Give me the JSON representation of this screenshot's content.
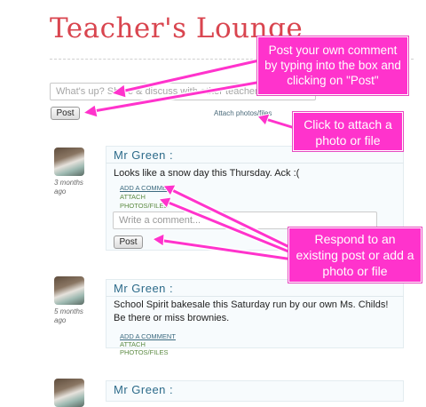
{
  "page": {
    "title": "Teacher's Lounge"
  },
  "composer": {
    "placeholder": "What's up? Share & discuss with other teachers",
    "post_label": "Post",
    "attach_label": "Attach photos/files"
  },
  "posts": [
    {
      "author": "Mr Green :",
      "ago": "3 months ago",
      "body": "Looks like a snow day this Thursday. Ack :(",
      "add_comment": "ADD A COMMENT",
      "attach": "ATTACH",
      "photos_files": "PHOTOS/FILES",
      "write_placeholder": "Write a comment...",
      "post_label": "Post"
    },
    {
      "author": "Mr Green :",
      "ago": "5 months ago",
      "body": "School Spirit bakesale this Saturday run by our own Ms. Childs! Be there or miss brownies.",
      "add_comment": "ADD A COMMENT",
      "attach": "ATTACH",
      "photos_files": "PHOTOS/FILES"
    },
    {
      "author": "Mr Green :"
    }
  ],
  "callouts": {
    "post_hint": "Post your own comment by typing into the box and clicking on \"Post\"",
    "attach_hint": "Click to attach a photo or file",
    "respond_hint": "Respond to an existing post or add a photo or file"
  },
  "colors": {
    "title": "#d9454f",
    "author": "#2d6b8a",
    "action_link": "#5d8b43",
    "callout": "#ff33cc"
  }
}
